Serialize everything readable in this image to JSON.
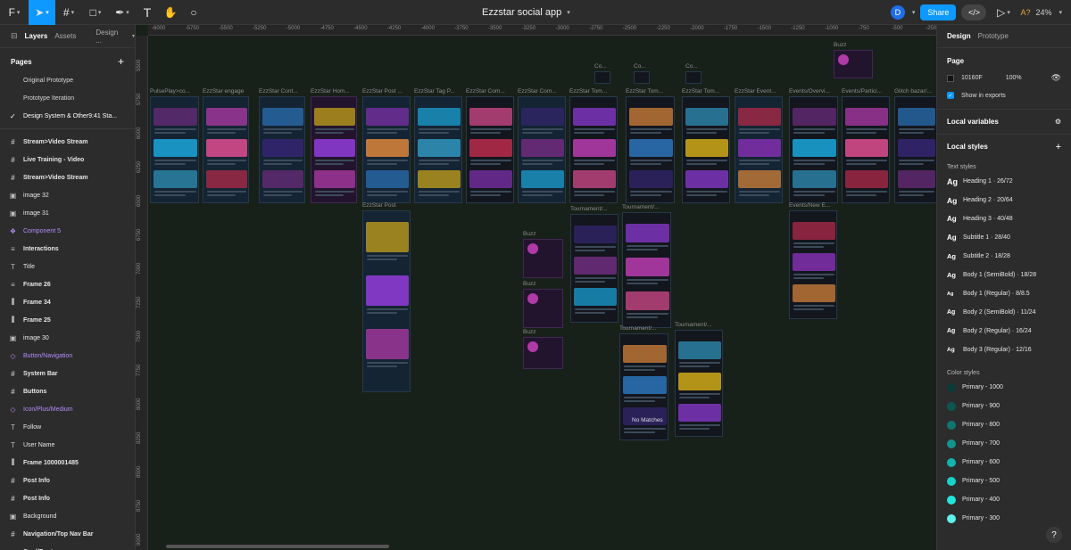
{
  "toolbar": {
    "file_name": "Ezzstar social app",
    "avatar_initial": "D",
    "share_label": "Share",
    "zoom": "24%",
    "font_status": "A?"
  },
  "left_panel": {
    "tabs": [
      "Layers",
      "Assets",
      "Design ..."
    ],
    "pages_title": "Pages",
    "pages": [
      {
        "label": "Original Prototype",
        "current": false
      },
      {
        "label": "Prototype Iteration",
        "current": false
      },
      {
        "label": "Design System & Other9:41 Sta...",
        "current": true
      }
    ],
    "layers": [
      {
        "label": "Stream>Video Stream",
        "icon": "hash-icon",
        "style": "bold"
      },
      {
        "label": "Live Training - Video",
        "icon": "hash-icon",
        "style": "bold"
      },
      {
        "label": "Stream>Video Stream",
        "icon": "hash-icon",
        "style": "bold"
      },
      {
        "label": "image 32",
        "icon": "image-icon",
        "style": "normal"
      },
      {
        "label": "image 31",
        "icon": "image-icon",
        "style": "normal"
      },
      {
        "label": "Component 5",
        "icon": "component-icon",
        "style": "purple"
      },
      {
        "label": "Interactions",
        "icon": "list-icon",
        "style": "bold"
      },
      {
        "label": "Title",
        "icon": "text-icon",
        "style": "normal"
      },
      {
        "label": "Frame 26",
        "icon": "list-icon",
        "style": "bold"
      },
      {
        "label": "Frame 34",
        "icon": "columns-icon",
        "style": "bold"
      },
      {
        "label": "Frame 25",
        "icon": "columns-icon",
        "style": "bold"
      },
      {
        "label": "image 30",
        "icon": "image-icon",
        "style": "normal"
      },
      {
        "label": "Button/Navigation",
        "icon": "instance-icon",
        "style": "purple"
      },
      {
        "label": "System Bar",
        "icon": "hash-icon",
        "style": "bold"
      },
      {
        "label": "Buttons",
        "icon": "hash-icon",
        "style": "bold"
      },
      {
        "label": "Icon/Plus/Medium",
        "icon": "instance-icon",
        "style": "purple"
      },
      {
        "label": "Follow",
        "icon": "text-icon",
        "style": "normal"
      },
      {
        "label": "User Name",
        "icon": "text-icon",
        "style": "normal"
      },
      {
        "label": "Frame 1000001485",
        "icon": "columns-icon",
        "style": "bold"
      },
      {
        "label": "Post Info",
        "icon": "hash-icon",
        "style": "bold"
      },
      {
        "label": "Post Info",
        "icon": "hash-icon",
        "style": "bold"
      },
      {
        "label": "Background",
        "icon": "image-icon",
        "style": "normal"
      },
      {
        "label": "Navigation/Top Nav Bar",
        "icon": "hash-icon",
        "style": "bold"
      },
      {
        "label": "Card/Post",
        "icon": "list-icon",
        "style": "bold"
      }
    ]
  },
  "right_panel": {
    "tabs": [
      "Design",
      "Prototype"
    ],
    "page_title": "Page",
    "bg_hex": "10160F",
    "bg_opacity": "100%",
    "show_in_exports": "Show in exports",
    "local_variables": "Local variables",
    "local_styles": "Local styles",
    "text_styles_title": "Text styles",
    "text_styles": [
      {
        "ag": "Ag",
        "label": "Heading 1 · 26/72"
      },
      {
        "ag": "Ag",
        "label": "Heading 2 · 20/64"
      },
      {
        "ag": "Ag",
        "label": "Heading 3 · 40/48"
      },
      {
        "ag": "Ag",
        "label": "Subtitle 1 · 28/40"
      },
      {
        "ag": "Ag",
        "label": "Subtitle 2 · 18/28"
      },
      {
        "ag": "Ag",
        "label": "Body 1 (SemiBold) · 18/28"
      },
      {
        "ag": "Ag",
        "label": "Body 1 (Regular) · 8/8.5"
      },
      {
        "ag": "Ag",
        "label": "Body 2 (SemiBold) · 11/24"
      },
      {
        "ag": "Ag",
        "label": "Body 2 (Regular) · 16/24"
      },
      {
        "ag": "Ag",
        "label": "Body 3 (Regular) · 12/16"
      }
    ],
    "color_styles_title": "Color styles",
    "color_styles": [
      {
        "label": "Primary - 1000",
        "color": "#0b3b36"
      },
      {
        "label": "Primary - 900",
        "color": "#0d5650"
      },
      {
        "label": "Primary - 800",
        "color": "#0e7670"
      },
      {
        "label": "Primary - 700",
        "color": "#10958e"
      },
      {
        "label": "Primary - 600",
        "color": "#12b5ad"
      },
      {
        "label": "Primary - 500",
        "color": "#14d3ca"
      },
      {
        "label": "Primary - 400",
        "color": "#22e6de"
      },
      {
        "label": "Primary - 300",
        "color": "#5ef1ea"
      }
    ],
    "help": "?"
  },
  "canvas": {
    "ruler_x": [
      "-6000",
      "-5750",
      "-5500",
      "-5250",
      "-5000",
      "-4750",
      "-4500",
      "-4250",
      "-4000",
      "-3750",
      "-3500",
      "-3250",
      "-3000",
      "-2750",
      "-2500",
      "-2250",
      "-2000",
      "-1750",
      "-1500",
      "-1250",
      "-1000",
      "-750",
      "-500",
      "-250"
    ],
    "ruler_y": [
      "5500",
      "5750",
      "6000",
      "6250",
      "6500",
      "6750",
      "7000",
      "7250",
      "7500",
      "7750",
      "8000",
      "8250",
      "8500",
      "8750",
      "9000"
    ],
    "frame_labels": [
      "PulsePlay>co...",
      "EzzStar engage",
      "EzzStar Cont...",
      "EzzStar Hom...",
      "EzzStar Post ...",
      "EzzStar Tag P...",
      "EzzStar Com...",
      "EzzStar Com...",
      "EzzStar Tom...",
      "EzzStar Tom...",
      "EzzStar Tom...",
      "EzzStar Event...",
      "Events/Overvi...",
      "Events/Partici...",
      "Glitch bazar/...",
      "EzzStar Post",
      "Buzz",
      "Buzz",
      "Buzz",
      "Tournament/...",
      "Tournament/...",
      "Tournament/...",
      "Tournament/...",
      "Events/New E...",
      "Buzz",
      "Co...",
      "Co...",
      "Co..."
    ],
    "no_matches": "No Matches"
  }
}
